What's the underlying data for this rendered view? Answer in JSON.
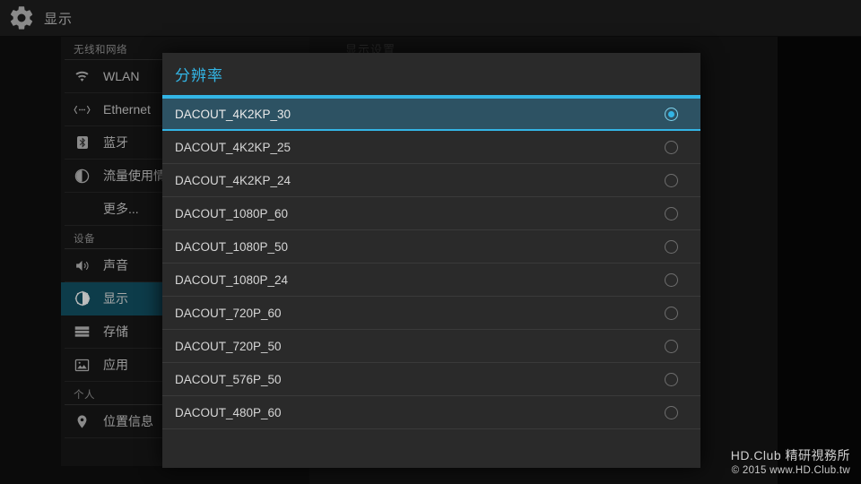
{
  "action_bar": {
    "icon": "gear-icon",
    "title": "显示"
  },
  "background": {
    "page_title": "显示设置"
  },
  "sidebar": {
    "sections": [
      {
        "header": "无线和网络",
        "items": [
          {
            "label": "WLAN",
            "icon": "wifi-icon",
            "selected": false
          },
          {
            "label": "Ethernet",
            "icon": "ethernet-icon",
            "selected": false
          },
          {
            "label": "蓝牙",
            "icon": "bluetooth-icon",
            "selected": false
          },
          {
            "label": "流量使用情况",
            "icon": "data-usage-icon",
            "selected": false
          },
          {
            "label": "更多...",
            "icon": "none",
            "selected": false
          }
        ]
      },
      {
        "header": "设备",
        "items": [
          {
            "label": "声音",
            "icon": "sound-icon",
            "selected": false
          },
          {
            "label": "显示",
            "icon": "display-icon",
            "selected": true
          },
          {
            "label": "存储",
            "icon": "storage-icon",
            "selected": false
          },
          {
            "label": "应用",
            "icon": "apps-icon",
            "selected": false
          }
        ]
      },
      {
        "header": "个人",
        "items": [
          {
            "label": "位置信息",
            "icon": "location-pin-icon",
            "selected": false
          }
        ]
      }
    ]
  },
  "dialog": {
    "title": "分辨率",
    "options": [
      {
        "label": "DACOUT_4K2KP_30",
        "selected": true
      },
      {
        "label": "DACOUT_4K2KP_25",
        "selected": false
      },
      {
        "label": "DACOUT_4K2KP_24",
        "selected": false
      },
      {
        "label": "DACOUT_1080P_60",
        "selected": false
      },
      {
        "label": "DACOUT_1080P_50",
        "selected": false
      },
      {
        "label": "DACOUT_1080P_24",
        "selected": false
      },
      {
        "label": "DACOUT_720P_60",
        "selected": false
      },
      {
        "label": "DACOUT_720P_50",
        "selected": false
      },
      {
        "label": "DACOUT_576P_50",
        "selected": false
      },
      {
        "label": "DACOUT_480P_60",
        "selected": false
      }
    ]
  },
  "watermark": {
    "line1": "HD.Club 精研視務所",
    "line2": "© 2015  www.HD.Club.tw"
  },
  "colors": {
    "accent": "#33b5e5",
    "selected_row_bg": "#2d5263",
    "sidebar_selected_bg": "#0d3c4a",
    "dialog_bg": "#2a2a2a",
    "screen_bg": "#000000"
  }
}
